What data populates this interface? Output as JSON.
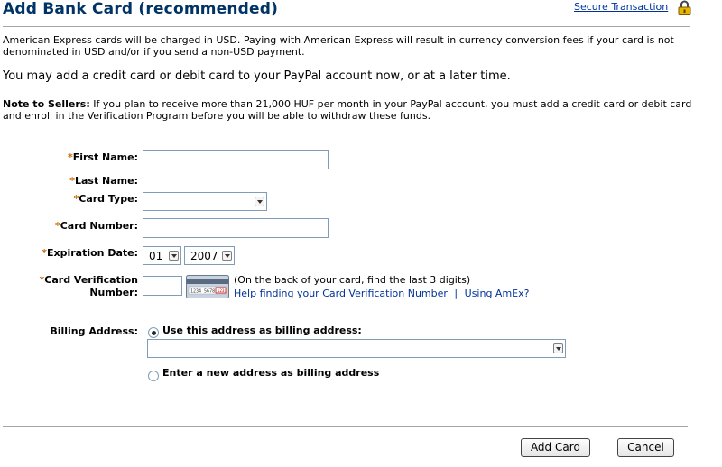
{
  "header": {
    "title": "Add Bank Card (recommended)",
    "secure_link": "Secure Transaction"
  },
  "info": {
    "amex_notice": "American Express cards will be charged in USD. Paying with American Express will result in currency conversion fees if your card is not denominated in USD and/or if you send a non-USD payment.",
    "add_now": "You may add a credit card or debit card to your PayPal account now, or at a later time.",
    "note_label": "Note to Sellers:",
    "note_text": " If you plan to receive more than 21,000 HUF per month in your PayPal account, you must add a credit card or debit card and enroll in the Verification Program before you will be able to withdraw these funds."
  },
  "form": {
    "required_mark": "*",
    "first_name": {
      "label": "First Name:",
      "value": ""
    },
    "last_name": {
      "label": "Last Name:",
      "value": ""
    },
    "card_type": {
      "label": "Card Type:",
      "value": ""
    },
    "card_number": {
      "label": "Card Number:",
      "value": ""
    },
    "expiration": {
      "label": "Expiration Date:",
      "month": "01",
      "year": "2007"
    },
    "cvv": {
      "label_line1": "Card Verification",
      "label_line2": "Number:",
      "value": "",
      "hint": "(On the back of your card, find the last 3 digits)",
      "help_link": "Help finding your Card Verification Number",
      "separator": "|",
      "amex_link": "Using AmEx?",
      "card_image_text": "1234 5678",
      "card_image_code": "123"
    },
    "billing": {
      "label": "Billing Address:",
      "option_existing": "Use this address as billing address:",
      "option_existing_selected": true,
      "existing_value": "",
      "option_new": "Enter a new address as billing address",
      "option_new_selected": false
    }
  },
  "actions": {
    "add_card": "Add Card",
    "cancel": "Cancel"
  },
  "colors": {
    "title": "#003366",
    "link": "#003399",
    "required": "#cc6600",
    "input_border": "#7f9db9"
  }
}
